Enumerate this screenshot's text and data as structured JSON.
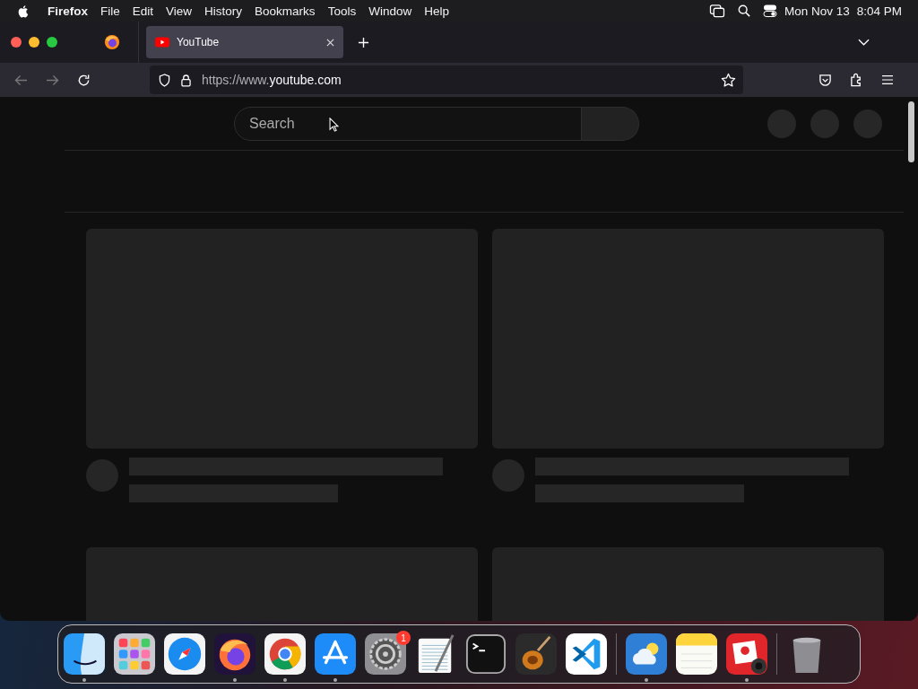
{
  "menubar": {
    "app": "Firefox",
    "items": [
      "File",
      "Edit",
      "View",
      "History",
      "Bookmarks",
      "Tools",
      "Window",
      "Help"
    ],
    "date": "Mon Nov 13",
    "time": "8:04 PM"
  },
  "tabs": [
    {
      "title": "YouTube",
      "selected": true
    }
  ],
  "address": {
    "prefix": "https://www.",
    "domain": "youtube.com"
  },
  "page": {
    "search": {
      "placeholder": "Search"
    }
  },
  "dock": [
    {
      "kind": "finder",
      "running": true
    },
    {
      "kind": "launchpad",
      "running": false
    },
    {
      "kind": "safari",
      "running": false
    },
    {
      "kind": "firefox",
      "running": true
    },
    {
      "kind": "chrome",
      "running": true
    },
    {
      "kind": "appstore",
      "running": true
    },
    {
      "kind": "settings",
      "running": false,
      "badge": "1"
    },
    {
      "kind": "textedit",
      "running": false
    },
    {
      "kind": "terminal",
      "running": false
    },
    {
      "kind": "garageband",
      "running": false
    },
    {
      "kind": "vscode",
      "running": false
    },
    {
      "kind": "separator"
    },
    {
      "kind": "weather",
      "running": true
    },
    {
      "kind": "notes",
      "running": false
    },
    {
      "kind": "photobooth",
      "running": true
    },
    {
      "kind": "separator"
    },
    {
      "kind": "trash",
      "running": false
    }
  ]
}
